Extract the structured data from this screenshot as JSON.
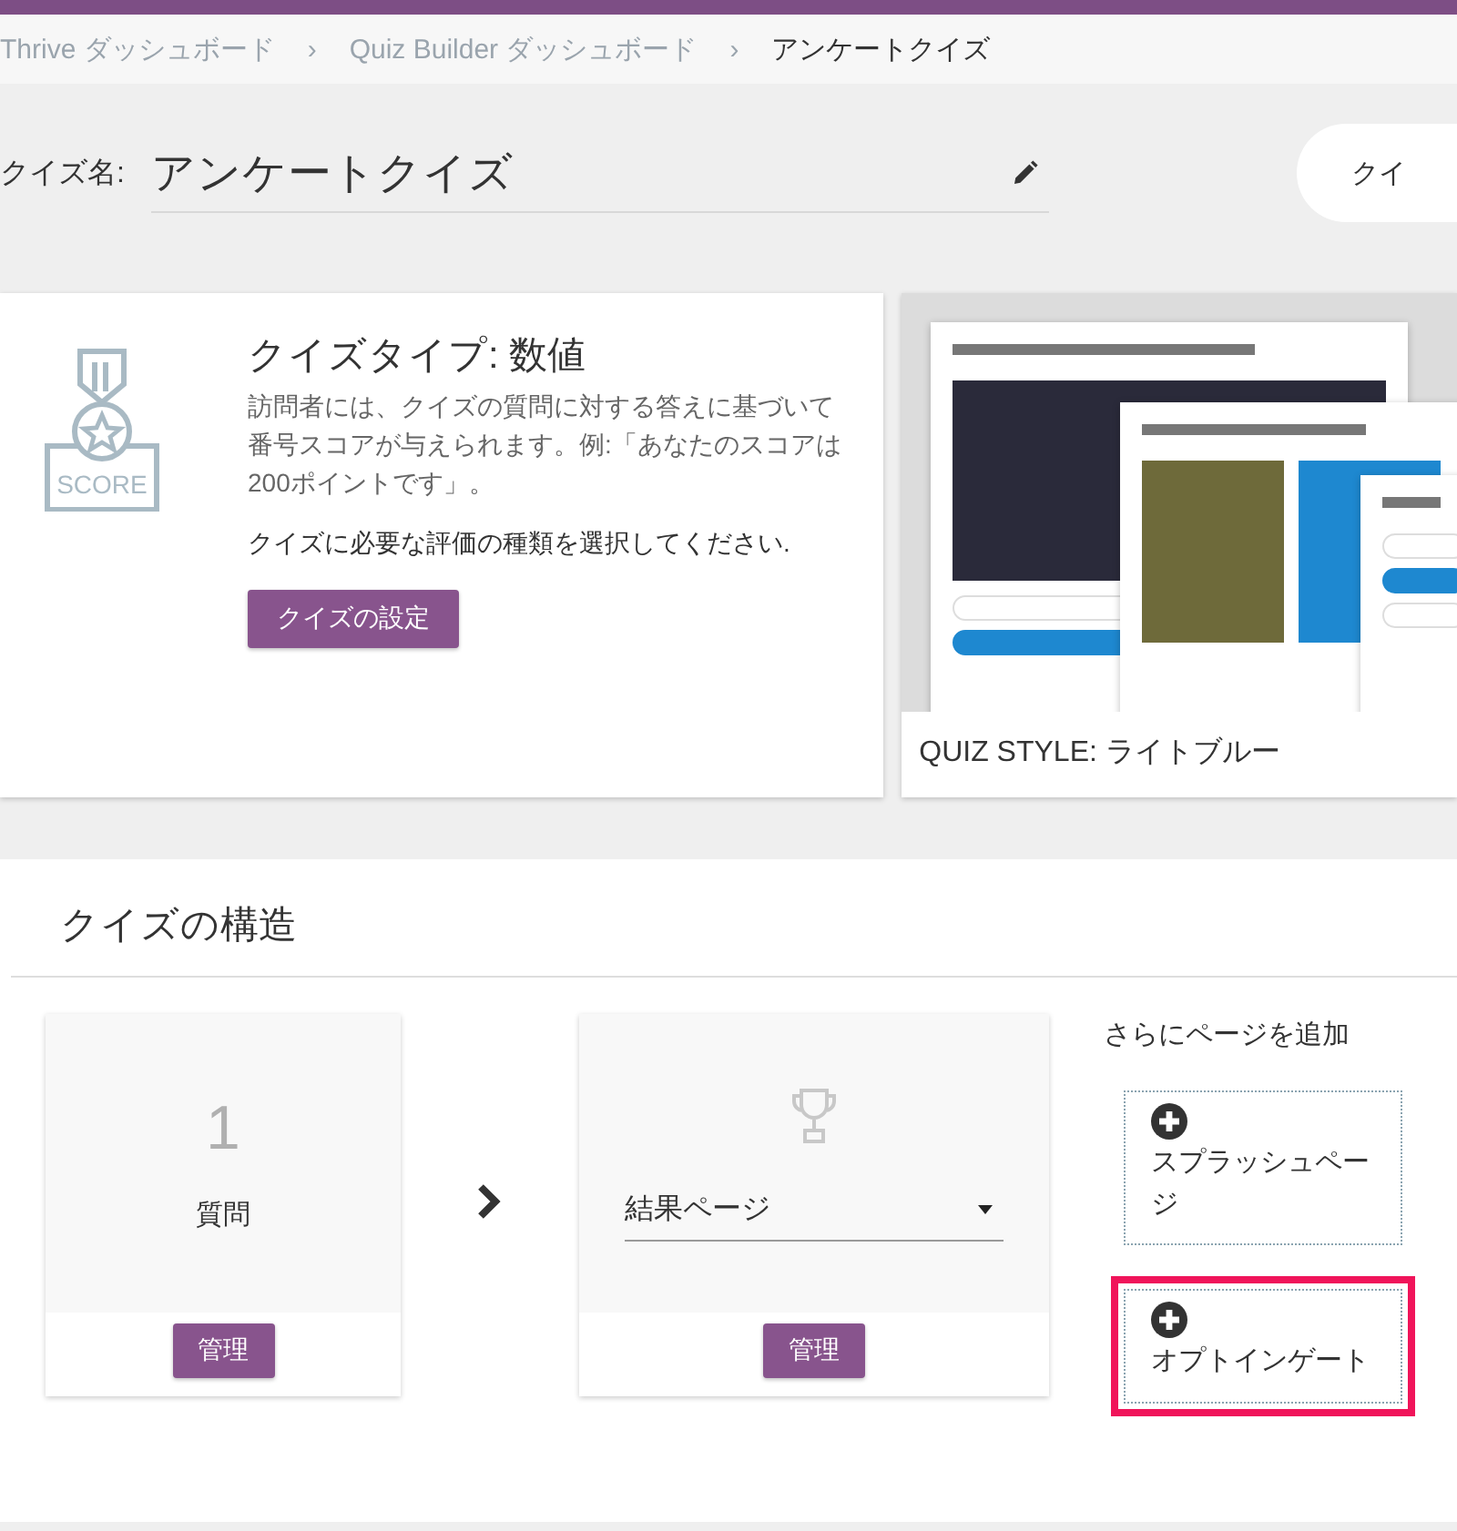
{
  "breadcrumbs": [
    {
      "label": "Thrive ダッシュボード",
      "separator": "›"
    },
    {
      "label": "Quiz Builder ダッシュボード",
      "separator": "›"
    },
    {
      "label": "アンケートクイズ"
    }
  ],
  "quiz_name": {
    "label": "クイズ名:",
    "value": "アンケートクイズ",
    "side_button": "クイ"
  },
  "quiz_type": {
    "badge_text": "SCORE",
    "title": "クイズタイプ: 数値",
    "description": "訪問者には、クイズの質問に対する答えに基づいて番号スコアが与えられます。例:「あなたのスコアは200ポイントです」。",
    "prompt": "クイズに必要な評価の種類を選択してください.",
    "button": "クイズの設定"
  },
  "quiz_style": {
    "caption": "QUIZ STYLE: ライトブルー"
  },
  "structure": {
    "title": "クイズの構造",
    "steps": [
      {
        "kind": "count",
        "number": "1",
        "label": "質問",
        "button": "管理"
      },
      {
        "kind": "select",
        "value": "結果ページ",
        "button": "管理"
      }
    ],
    "add_pages": {
      "title": "さらにページを追加",
      "items": [
        {
          "label": "スプラッシュページ",
          "highlighted": false
        },
        {
          "label": "オプトインゲート",
          "highlighted": true
        }
      ]
    }
  }
}
